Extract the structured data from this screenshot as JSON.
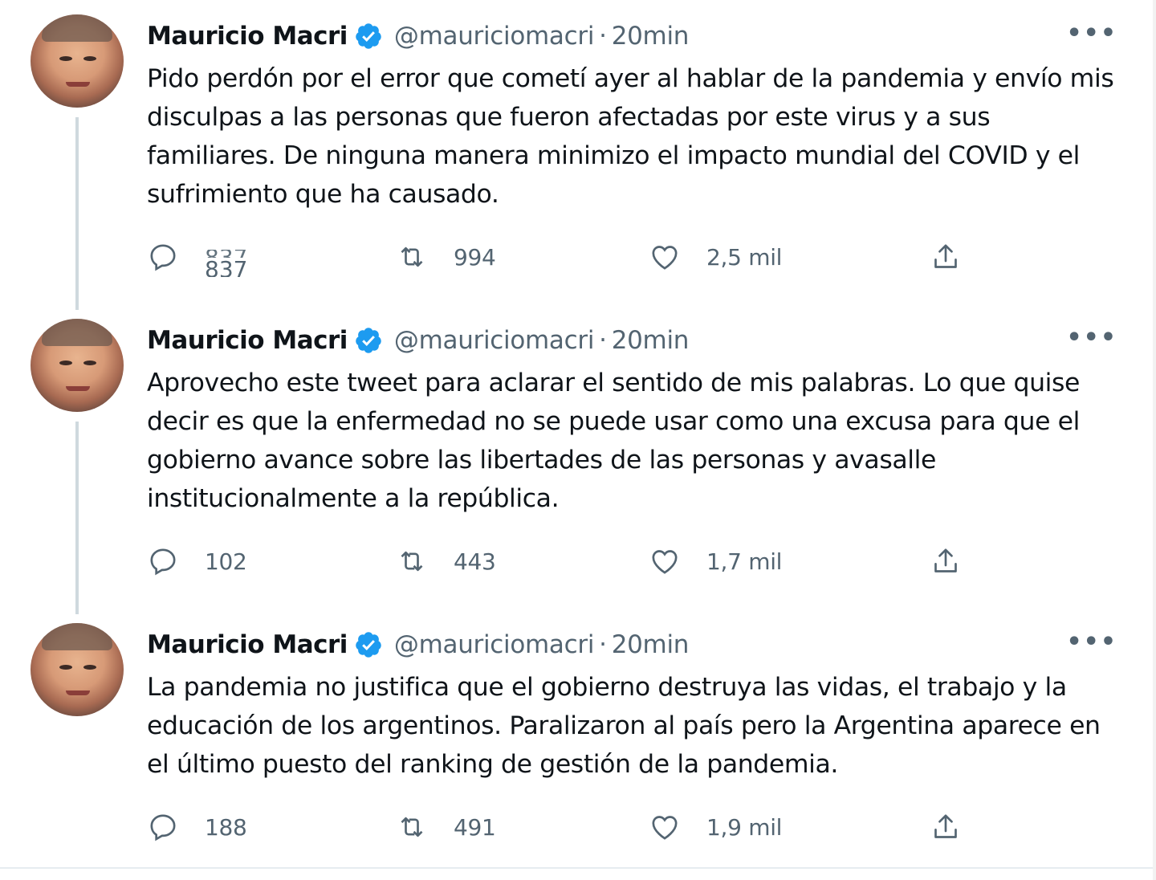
{
  "accent_color": "#1d9bf0",
  "tweets": [
    {
      "author": "Mauricio Macri",
      "handle": "@mauriciomacri",
      "separator": "·",
      "time": "20min",
      "text": "Pido perdón por el error que cometí ayer al hablar de la pandemia y envío mis disculpas a las personas que fueron afectadas por este virus y a sus familiares. De ninguna manera minimizo el impacto mundial del COVID y el sufrimiento que ha causado.",
      "replies": "837",
      "retweets": "994",
      "likes": "2,5 mil"
    },
    {
      "author": "Mauricio Macri",
      "handle": "@mauriciomacri",
      "separator": "·",
      "time": "20min",
      "text": "Aprovecho este tweet para aclarar el sentido de mis palabras. Lo que quise decir es que la enfermedad no se puede usar como una excusa para que el gobierno avance sobre las libertades de las personas y avasalle institucionalmente a la república.",
      "replies": "102",
      "retweets": "443",
      "likes": "1,7 mil"
    },
    {
      "author": "Mauricio Macri",
      "handle": "@mauriciomacri",
      "separator": "·",
      "time": "20min",
      "text": "La pandemia no justifica que el gobierno destruya las vidas, el trabajo y la educación de los argentinos. Paralizaron al país pero la Argentina aparece en el último puesto del ranking de gestión de la pandemia.",
      "replies": "188",
      "retweets": "491",
      "likes": "1,9 mil"
    }
  ],
  "icons": {
    "more": "more-horizontal-icon",
    "reply": "reply-icon",
    "retweet": "retweet-icon",
    "like": "heart-icon",
    "share": "share-icon",
    "verified": "verified-badge-icon"
  }
}
